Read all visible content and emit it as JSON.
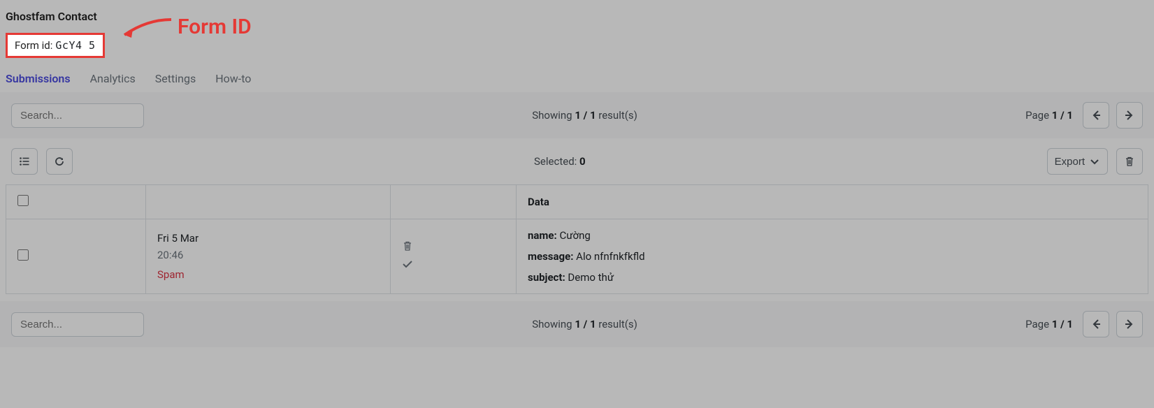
{
  "header": {
    "title": "Ghostfam Contact",
    "form_id_label": "Form id:",
    "form_id_value": "GcY4       5"
  },
  "annotation": {
    "label": "Form ID"
  },
  "tabs": {
    "submissions": "Submissions",
    "analytics": "Analytics",
    "settings": "Settings",
    "howto": "How-to"
  },
  "toolbar": {
    "search_placeholder": "Search...",
    "showing_prefix": "Showing ",
    "showing_count": "1 / 1",
    "showing_suffix": " result(s)",
    "page_prefix": "Page ",
    "page_count": "1 / 1"
  },
  "secondary": {
    "selected_prefix": "Selected: ",
    "selected_count": "0",
    "export_label": "Export"
  },
  "table": {
    "head": {
      "data": "Data"
    },
    "rows": [
      {
        "date": "Fri 5 Mar",
        "time": "20:46",
        "spam": "Spam",
        "data": [
          {
            "k": "name",
            "v": "Cường"
          },
          {
            "k": "message",
            "v": "Alo nfnfnkfkfld"
          },
          {
            "k": "subject",
            "v": "Demo thử"
          }
        ]
      }
    ]
  }
}
